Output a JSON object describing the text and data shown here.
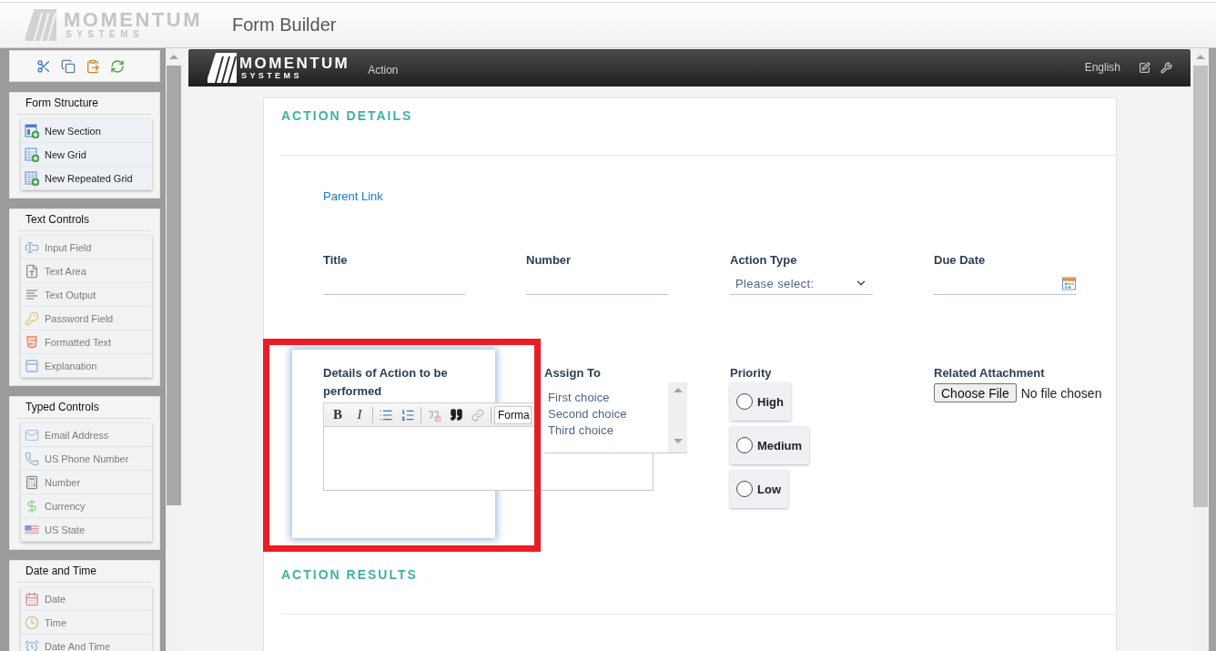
{
  "app_header": {
    "logo": {
      "name": "MOMENTUM",
      "tagline": "SYSTEMS"
    },
    "title": "Form Builder"
  },
  "palette": {
    "groups": [
      {
        "title": "Form Structure",
        "items": [
          {
            "kind": "section",
            "label": "New Section",
            "disabled": false
          },
          {
            "kind": "grid",
            "label": "New Grid",
            "disabled": false
          },
          {
            "kind": "repeatgrid",
            "label": "New Repeated Grid",
            "disabled": false
          }
        ]
      },
      {
        "title": "Text Controls",
        "items": [
          {
            "kind": "input",
            "label": "Input Field",
            "disabled": true
          },
          {
            "kind": "textarea",
            "label": "Text Area",
            "disabled": true
          },
          {
            "kind": "output",
            "label": "Text Output",
            "disabled": true
          },
          {
            "kind": "password",
            "label": "Password Field",
            "disabled": true
          },
          {
            "kind": "html",
            "label": "Formatted Text",
            "disabled": true
          },
          {
            "kind": "explanation",
            "label": "Explanation",
            "disabled": true
          }
        ]
      },
      {
        "title": "Typed Controls",
        "items": [
          {
            "kind": "email",
            "label": "Email Address",
            "disabled": true
          },
          {
            "kind": "phone",
            "label": "US Phone Number",
            "disabled": true
          },
          {
            "kind": "number",
            "label": "Number",
            "disabled": true
          },
          {
            "kind": "currency",
            "label": "Currency",
            "disabled": true
          },
          {
            "kind": "state",
            "label": "US State",
            "disabled": true
          }
        ]
      },
      {
        "title": "Date and Time",
        "items": [
          {
            "kind": "date",
            "label": "Date",
            "disabled": true
          },
          {
            "kind": "time",
            "label": "Time",
            "disabled": true
          },
          {
            "kind": "datetime",
            "label": "Date And Time",
            "disabled": true
          }
        ]
      }
    ]
  },
  "form": {
    "header": {
      "logo": {
        "name": "MOMENTUM",
        "tagline": "SYSTEMS"
      },
      "title": "Action",
      "language": "English"
    },
    "sections": [
      {
        "title": "ACTION DETAILS",
        "link": "Parent Link",
        "rows": [
          {
            "fields": [
              {
                "kind": "text",
                "label": "Title"
              },
              {
                "kind": "text",
                "label": "Number"
              },
              {
                "kind": "select",
                "label": "Action Type",
                "value": "Please select:"
              },
              {
                "kind": "date",
                "label": "Due Date"
              }
            ]
          },
          {
            "fields": [
              {
                "kind": "richtext",
                "label": "Details of Action to be performed",
                "highlighted": true,
                "toolbar": [
                  [
                    {
                      "kind": "bold",
                      "label": "B",
                      "disabled": false
                    },
                    {
                      "kind": "italic",
                      "label": "I",
                      "disabled": false
                    }
                  ],
                  [
                    {
                      "kind": "bullets",
                      "disabled": false
                    },
                    {
                      "kind": "numbers",
                      "disabled": false
                    }
                  ],
                  [
                    {
                      "kind": "unquote",
                      "disabled": true
                    },
                    {
                      "kind": "quote",
                      "disabled": false
                    },
                    {
                      "kind": "link",
                      "disabled": true
                    }
                  ]
                ],
                "format": "Forma"
              },
              {
                "kind": "listbox",
                "label": "Assign To",
                "options": [
                  {
                    "label": "First choice",
                    "selected": false
                  },
                  {
                    "label": "Second choice",
                    "selected": false
                  },
                  {
                    "label": "Third choice",
                    "selected": false
                  }
                ]
              },
              {
                "kind": "radio",
                "label": "Priority",
                "options": [
                  {
                    "label": "High",
                    "checked": false
                  },
                  {
                    "label": "Medium",
                    "checked": false
                  },
                  {
                    "label": "Low",
                    "checked": false
                  }
                ]
              },
              {
                "kind": "file",
                "label": "Related Attachment",
                "button": "Choose File",
                "status": "No file chosen"
              }
            ]
          }
        ]
      },
      {
        "title": "ACTION RESULTS"
      }
    ]
  }
}
